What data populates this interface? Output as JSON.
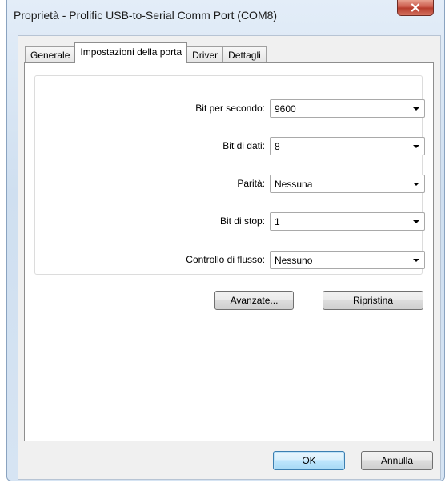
{
  "window": {
    "title": "Proprietà - Prolific USB-to-Serial Comm Port (COM8)",
    "close_icon": "close-x-icon"
  },
  "tabs": [
    {
      "label": "Generale",
      "active": false
    },
    {
      "label": "Impostazioni della porta",
      "active": true
    },
    {
      "label": "Driver",
      "active": false
    },
    {
      "label": "Dettagli",
      "active": false
    }
  ],
  "port_settings": {
    "fields": [
      {
        "label": "Bit per secondo:",
        "value": "9600"
      },
      {
        "label": "Bit di dati:",
        "value": "8"
      },
      {
        "label": "Parità:",
        "value": "Nessuna"
      },
      {
        "label": "Bit di stop:",
        "value": "1"
      },
      {
        "label": "Controllo di flusso:",
        "value": "Nessuno"
      }
    ],
    "advanced_button": "Avanzate...",
    "restore_button": "Ripristina"
  },
  "footer": {
    "ok_button": "OK",
    "cancel_button": "Annulla"
  },
  "colors": {
    "close_button": "#c75243",
    "default_button_border": "#3c7fb1"
  }
}
